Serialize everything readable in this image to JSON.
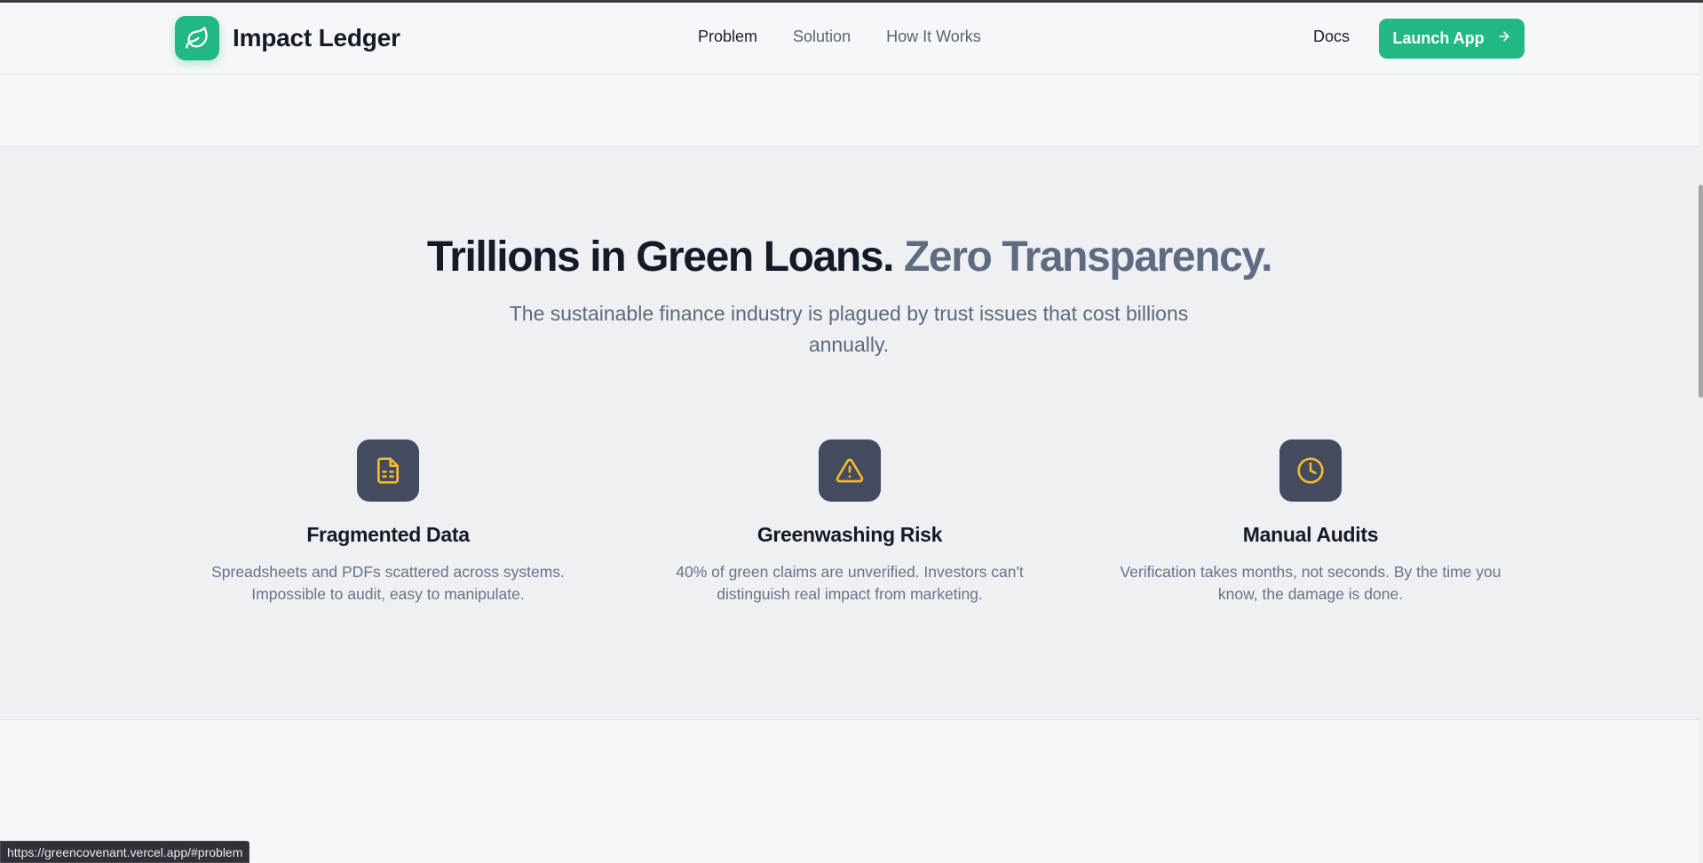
{
  "nav": {
    "brand": "Impact Ledger",
    "links": [
      {
        "label": "Problem",
        "active": true
      },
      {
        "label": "Solution",
        "active": false
      },
      {
        "label": "How It Works",
        "active": false
      }
    ],
    "docs": "Docs",
    "cta": "Launch App"
  },
  "problem": {
    "headline_main": "Trillions in Green Loans.",
    "headline_accent": "Zero Transparency.",
    "subtitle": "The sustainable finance industry is plagued by trust issues that cost billions annually.",
    "features": [
      {
        "icon": "document-icon",
        "title": "Fragmented Data",
        "desc": "Spreadsheets and PDFs scattered across systems. Impossible to audit, easy to manipulate."
      },
      {
        "icon": "warning-icon",
        "title": "Greenwashing Risk",
        "desc": "40% of green claims are unverified. Investors can't distinguish real impact from marketing."
      },
      {
        "icon": "clock-icon",
        "title": "Manual Audits",
        "desc": "Verification takes months, not seconds. By the time you know, the damage is done."
      }
    ]
  },
  "status_url": "https://greencovenant.vercel.app/#problem",
  "colors": {
    "brand": "#21b883",
    "icon_tile": "#434b5e",
    "icon_accent": "#f5b82e",
    "headline_muted": "#5f6b80"
  }
}
